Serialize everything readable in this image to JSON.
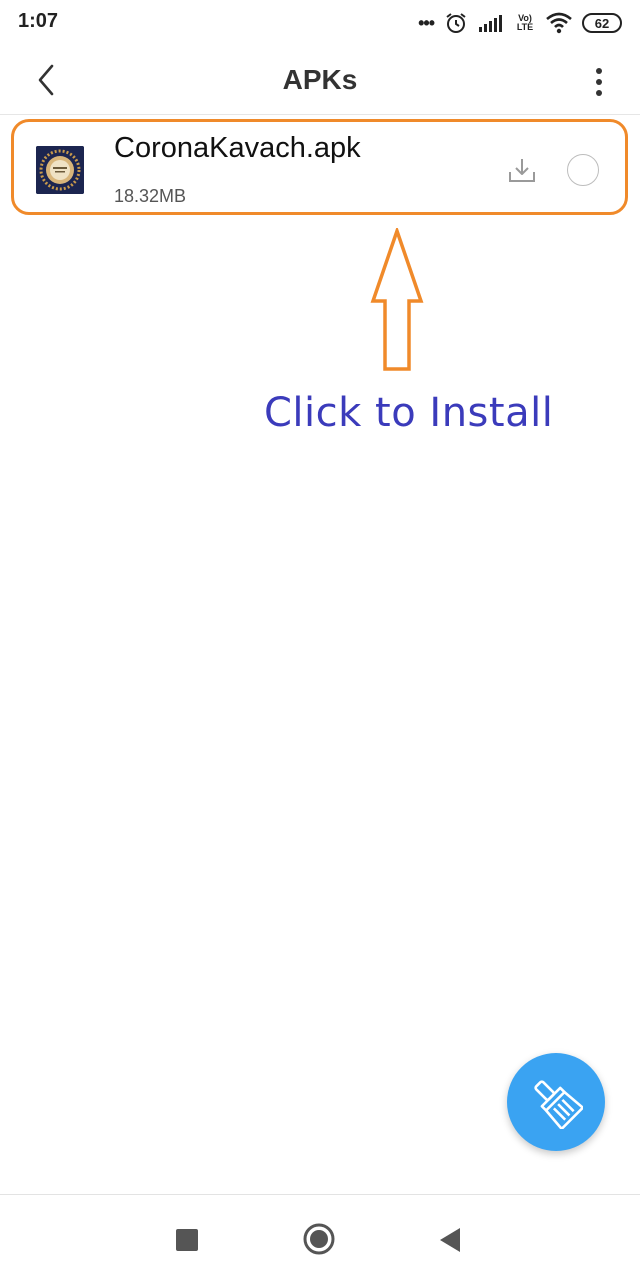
{
  "status_bar": {
    "time": "1:07",
    "dots": "•••",
    "network_label_top": "Vo)",
    "network_label_bottom": "LTE",
    "battery": "62"
  },
  "app_bar": {
    "title": "APKs",
    "back_icon": "chevron-left-icon",
    "menu_icon": "more-vertical-icon"
  },
  "files": [
    {
      "name": "CoronaKavach.apk",
      "size": "18.32MB",
      "icon": "app-icon",
      "action_icon": "download-tray-icon"
    }
  ],
  "annotation": {
    "text": "Click to Install",
    "color": "#3b3bbb",
    "frame_color": "#f08a2a"
  },
  "fab": {
    "icon": "broom-clean-icon",
    "color": "#3aa3f2"
  },
  "nav_bar": {
    "recent_icon": "square-icon",
    "home_icon": "circle-icon",
    "back_icon": "triangle-back-icon"
  }
}
